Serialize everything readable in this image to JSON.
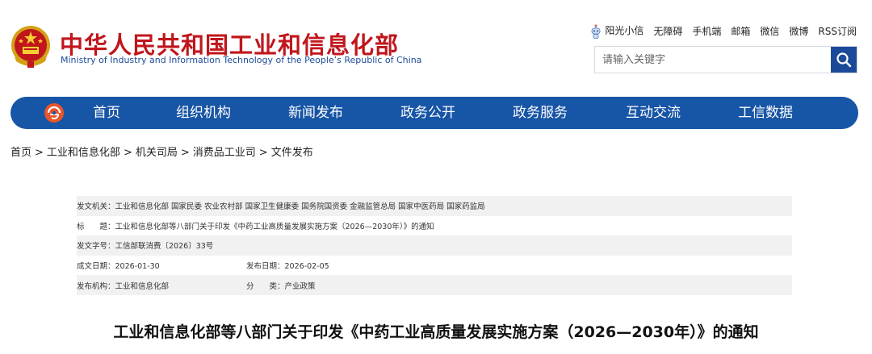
{
  "site": {
    "title_cn": "中华人民共和国工业和信息化部",
    "title_en": "Ministry of Industry and Information Technology of the People’s Republic of China"
  },
  "toplinks": [
    "阳光小信",
    "无障碍",
    "手机端",
    "邮箱",
    "微信",
    "微博",
    "RSS订阅"
  ],
  "search": {
    "placeholder": "请输入关键字"
  },
  "nav": [
    "首页",
    "组织机构",
    "新闻发布",
    "政务公开",
    "政务服务",
    "互动交流",
    "工信数据"
  ],
  "breadcrumb": [
    "首页",
    "工业和信息化部",
    "机关司局",
    "消费品工业司",
    "文件发布"
  ],
  "breadcrumb_sep": ">",
  "info": {
    "issuer_label": "发文机关：",
    "issuer": "工业和信息化部 国家民委 农业农村部 国家卫生健康委 国务院国资委 金融监管总局 国家中医药局 国家药监局",
    "title_label": "标　　题：",
    "title": "工业和信息化部等八部门关于印发《中药工业高质量发展实施方案（2026—2030年）》的通知",
    "docno_label": "发文字号：",
    "docno": "工信部联消费〔2026〕33号",
    "created_label": "成文日期：",
    "created": "2026-01-30",
    "published_label": "发布日期：",
    "published": "2026-02-05",
    "org_label": "发布机构：",
    "org": "工业和信息化部",
    "category_label": "分　　类：",
    "category": "产业政策"
  },
  "article": {
    "title": "工业和信息化部等八部门关于印发《中药工业高质量发展实施方案（2026—2030年）》的通知"
  },
  "colors": {
    "brand_red": "#c0161c",
    "nav_blue": "#1755a6",
    "search_blue": "#1c4a9a",
    "row_shade": "#f1f1f1"
  },
  "icons": [
    "national-emblem-icon",
    "robot-icon",
    "search-icon",
    "nav-logo-icon"
  ]
}
